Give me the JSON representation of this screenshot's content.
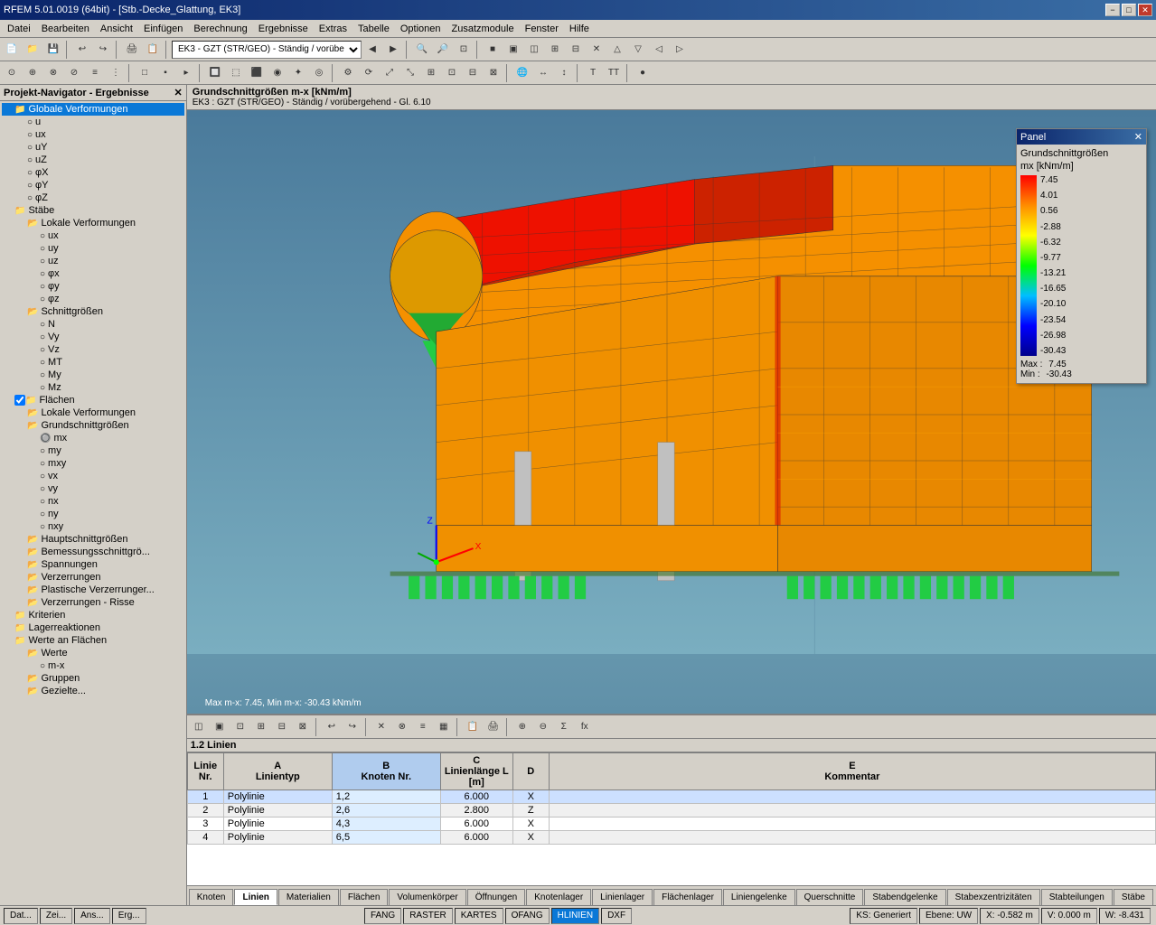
{
  "titlebar": {
    "title": "RFEM 5.01.0019 (64bit) - [Stb.-Decke_Glattung, EK3]",
    "min_label": "−",
    "max_label": "□",
    "close_label": "✕",
    "inner_min": "−",
    "inner_max": "□",
    "inner_close": "✕"
  },
  "menubar": {
    "items": [
      "Datei",
      "Bearbeiten",
      "Ansicht",
      "Einfügen",
      "Berechnung",
      "Ergebnisse",
      "Extras",
      "Tabelle",
      "Optionen",
      "Zusatzmodule",
      "Fenster",
      "Hilfe"
    ]
  },
  "toolbar1": {
    "combo": "EK3 - GZT (STR/GEO) - Ständig / vorübe"
  },
  "sidebar": {
    "title": "Projekt-Navigator - Ergebnisse",
    "items": [
      {
        "label": "Globale Verformungen",
        "indent": 1,
        "type": "folder",
        "selected": true
      },
      {
        "label": "u",
        "indent": 2,
        "type": "radio"
      },
      {
        "label": "ux",
        "indent": 2,
        "type": "radio"
      },
      {
        "label": "uY",
        "indent": 2,
        "type": "radio"
      },
      {
        "label": "uZ",
        "indent": 2,
        "type": "radio"
      },
      {
        "label": "φX",
        "indent": 2,
        "type": "radio"
      },
      {
        "label": "φY",
        "indent": 2,
        "type": "radio"
      },
      {
        "label": "φZ",
        "indent": 2,
        "type": "radio"
      },
      {
        "label": "Stäbe",
        "indent": 1,
        "type": "folder"
      },
      {
        "label": "Lokale Verformungen",
        "indent": 2,
        "type": "subfolder"
      },
      {
        "label": "ux",
        "indent": 3,
        "type": "radio"
      },
      {
        "label": "uy",
        "indent": 3,
        "type": "radio"
      },
      {
        "label": "uz",
        "indent": 3,
        "type": "radio"
      },
      {
        "label": "φx",
        "indent": 3,
        "type": "radio"
      },
      {
        "label": "φy",
        "indent": 3,
        "type": "radio"
      },
      {
        "label": "φz",
        "indent": 3,
        "type": "radio"
      },
      {
        "label": "Schnittgrößen",
        "indent": 2,
        "type": "subfolder"
      },
      {
        "label": "N",
        "indent": 3,
        "type": "radio"
      },
      {
        "label": "Vy",
        "indent": 3,
        "type": "radio"
      },
      {
        "label": "Vz",
        "indent": 3,
        "type": "radio"
      },
      {
        "label": "MT",
        "indent": 3,
        "type": "radio"
      },
      {
        "label": "My",
        "indent": 3,
        "type": "radio"
      },
      {
        "label": "Mz",
        "indent": 3,
        "type": "radio"
      },
      {
        "label": "Flächen",
        "indent": 1,
        "type": "folder",
        "checked": true
      },
      {
        "label": "Lokale Verformungen",
        "indent": 2,
        "type": "subfolder"
      },
      {
        "label": "Grundschnittgrößen",
        "indent": 2,
        "type": "subfolder",
        "active": true
      },
      {
        "label": "mx",
        "indent": 3,
        "type": "radio",
        "active": true
      },
      {
        "label": "my",
        "indent": 3,
        "type": "radio"
      },
      {
        "label": "mxy",
        "indent": 3,
        "type": "radio"
      },
      {
        "label": "vx",
        "indent": 3,
        "type": "radio"
      },
      {
        "label": "vy",
        "indent": 3,
        "type": "radio"
      },
      {
        "label": "nx",
        "indent": 3,
        "type": "radio"
      },
      {
        "label": "ny",
        "indent": 3,
        "type": "radio"
      },
      {
        "label": "nxy",
        "indent": 3,
        "type": "radio"
      },
      {
        "label": "Hauptschnittgrößen",
        "indent": 2,
        "type": "subfolder"
      },
      {
        "label": "Bemessungsschnittgrö...",
        "indent": 2,
        "type": "subfolder"
      },
      {
        "label": "Spannungen",
        "indent": 2,
        "type": "subfolder"
      },
      {
        "label": "Verzerrungen",
        "indent": 2,
        "type": "subfolder"
      },
      {
        "label": "Plastische Verzerrunger...",
        "indent": 2,
        "type": "subfolder"
      },
      {
        "label": "Verzerrungen - Risse",
        "indent": 2,
        "type": "subfolder"
      },
      {
        "label": "Kriterien",
        "indent": 1,
        "type": "folder"
      },
      {
        "label": "Lagerreaktionen",
        "indent": 1,
        "type": "folder"
      },
      {
        "label": "Werte an Flächen",
        "indent": 1,
        "type": "folder"
      },
      {
        "label": "Werte",
        "indent": 2,
        "type": "subfolder"
      },
      {
        "label": "m-x",
        "indent": 3,
        "type": "radio"
      },
      {
        "label": "Gruppen",
        "indent": 2,
        "type": "subfolder"
      },
      {
        "label": "Gezielte...",
        "indent": 2,
        "type": "subfolder"
      }
    ]
  },
  "viewport": {
    "header_title": "Grundschnittgrößen m-x [kNm/m]",
    "header_line2": "EK3 : GZT (STR/GEO) - Ständig / vorübergehend - Gl. 6.10",
    "bottom_label": "Max m-x: 7.45, Min m-x: -30.43 kNm/m"
  },
  "panel": {
    "title": "Panel",
    "section_title": "Grundschnittgrößen",
    "subtitle": "mx [kNm/m]",
    "scale_values": [
      "7.45",
      "4.01",
      "0.56",
      "-2.88",
      "-6.32",
      "-9.77",
      "-13.21",
      "-16.65",
      "-20.10",
      "-23.54",
      "-26.98",
      "-30.43"
    ],
    "max_label": "Max :",
    "max_value": "7.45",
    "min_label": "Min :",
    "min_value": "-30.43"
  },
  "bottom_panel": {
    "header": "1.2 Linien",
    "columns": {
      "nr": "Linie Nr.",
      "a": "A\nLinientyp",
      "b": "B\nKnoten Nr.",
      "c": "C\nLinienlänge L [m]",
      "d": "D",
      "e": "E\nKommentar"
    },
    "rows": [
      {
        "nr": "1",
        "linientyp": "Polylinie",
        "knoten_nr": "1,2",
        "laenge": "6.000",
        "d": "X"
      },
      {
        "nr": "2",
        "linientyp": "Polylinie",
        "knoten_nr": "2,6",
        "laenge": "2.800",
        "d": "Z"
      },
      {
        "nr": "3",
        "linientyp": "Polylinie",
        "knoten_nr": "4,3",
        "laenge": "6.000",
        "d": "X"
      },
      {
        "nr": "4",
        "linientyp": "Polylinie",
        "knoten_nr": "6,5",
        "laenge": "6.000",
        "d": "X"
      }
    ]
  },
  "tabs": {
    "items": [
      "Knoten",
      "Linien",
      "Materialien",
      "Flächen",
      "Volumenkörper",
      "Öffnungen",
      "Knotenlager",
      "Linienlager",
      "Flächenlager",
      "Liniengelenke",
      "Querschnitte",
      "Stabendgelenke",
      "Stabexzentrizitäten",
      "Stabteilungen",
      "Stäbe"
    ],
    "active": "Linien"
  },
  "statusbar": {
    "items": [
      "Dat...",
      "Zei...",
      "Ans...",
      "Erg..."
    ],
    "status_items": [
      "FANG",
      "RASTER",
      "KARTES",
      "OFANG",
      "HLINIEN",
      "DXF"
    ],
    "ks": "KS: Generiert",
    "ebene": "Ebene: UW",
    "x_coord": "X: -0.582 m",
    "y_coord": "V: 0.000 m",
    "w_coord": "W: -8.431"
  },
  "colors": {
    "titlebar_bg": "#0a246a",
    "selected_bg": "#0a78d7",
    "active_tab_bg": "#ffffff"
  }
}
